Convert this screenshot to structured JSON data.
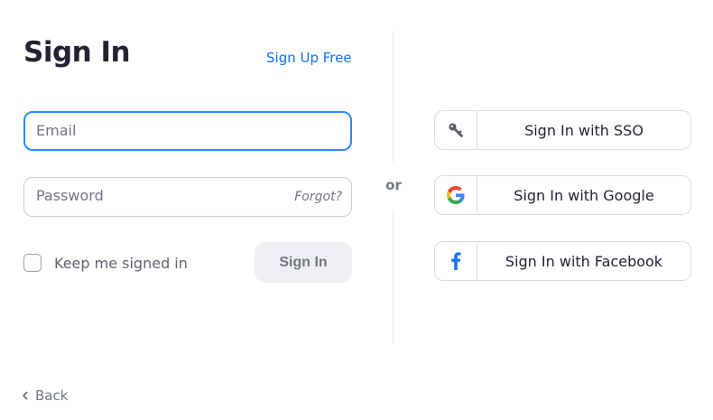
{
  "header": {
    "title": "Sign In",
    "signup_link": "Sign Up Free"
  },
  "form": {
    "email": {
      "value": "",
      "placeholder": "Email"
    },
    "password": {
      "value": "",
      "placeholder": "Password",
      "forgot_label": "Forgot?"
    },
    "keep_signed_in": {
      "label": "Keep me signed in",
      "checked": false
    },
    "submit_label": "Sign In"
  },
  "divider": {
    "label": "or"
  },
  "alternatives": [
    {
      "label": "Sign In with SSO",
      "icon": "key-icon"
    },
    {
      "label": "Sign In with Google",
      "icon": "google-icon"
    },
    {
      "label": "Sign In with Facebook",
      "icon": "facebook-icon"
    }
  ],
  "footer": {
    "back_label": "Back"
  },
  "colors": {
    "link": "#0e72ed",
    "focus_border": "#2d8cff",
    "facebook": "#1877f2",
    "primary_disabled_bg": "#efeff3"
  }
}
